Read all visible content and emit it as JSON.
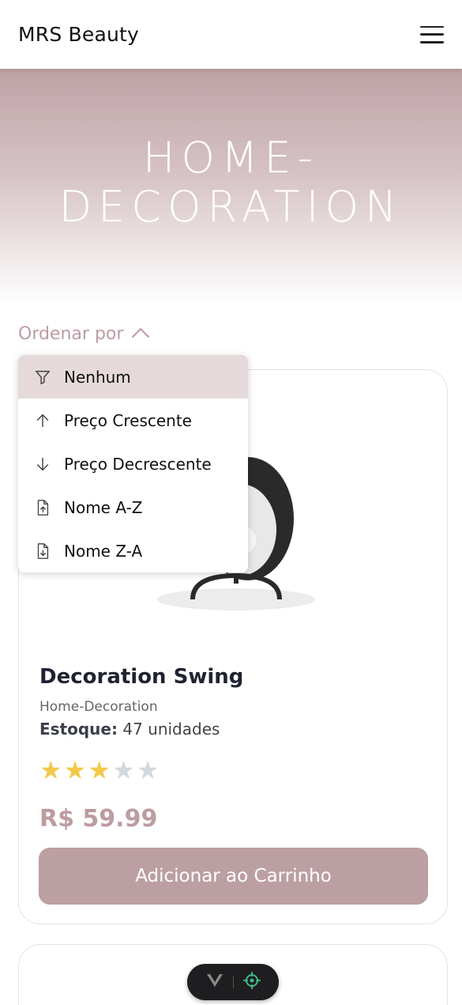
{
  "header": {
    "brand": "MRS Beauty",
    "menu_icon": "hamburger-menu-icon"
  },
  "hero": {
    "title": "HOME-DECORATION"
  },
  "sort": {
    "label": "Ordenar por",
    "toggle_icon": "chevron-up-icon",
    "options": [
      {
        "label": "Nenhum",
        "icon": "filter-icon",
        "active": true
      },
      {
        "label": "Preço Crescente",
        "icon": "arrow-up-icon",
        "active": false
      },
      {
        "label": "Preço Decrescente",
        "icon": "arrow-down-icon",
        "active": false
      },
      {
        "label": "Nome A-Z",
        "icon": "file-up-icon",
        "active": false
      },
      {
        "label": "Nome Z-A",
        "icon": "file-down-icon",
        "active": false
      }
    ]
  },
  "product": {
    "name": "Decoration Swing",
    "category": "Home-Decoration",
    "stock_label": "Estoque:",
    "stock_value": "47 unidades",
    "rating": 3,
    "rating_max": 5,
    "price": "R$ 59.99",
    "add_button": "Adicionar ao Carrinho"
  },
  "colors": {
    "accent": "#bc9fa3",
    "active_option": "#e5d9da",
    "star": "#f2c94c"
  },
  "devtools": {
    "logo_icon": "vue-logo-icon",
    "inspect_icon": "crosshair-icon"
  }
}
